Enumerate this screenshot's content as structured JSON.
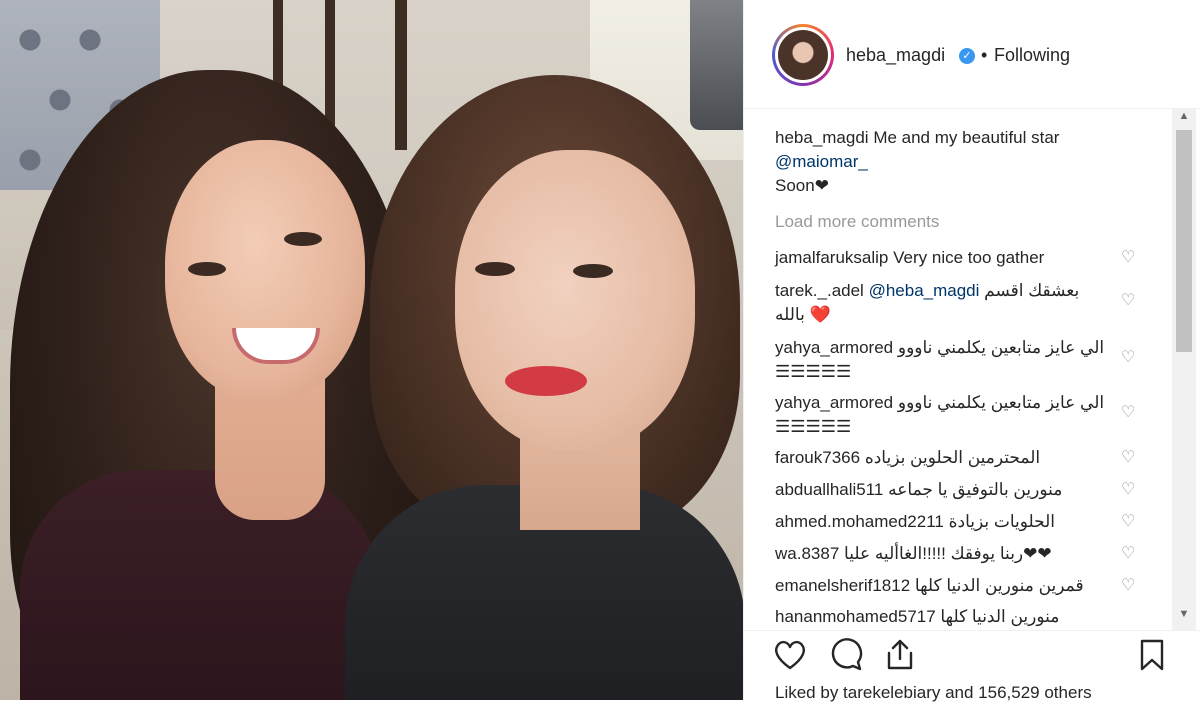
{
  "post": {
    "username": "heba_magdi",
    "verified": true,
    "separator": "•",
    "follow_status": "Following",
    "caption": {
      "user": "heba_magdi",
      "text": "Me and my beautiful star",
      "mention": "@maiomar_",
      "line3": "Soon❤"
    },
    "load_more": "Load more comments",
    "likes_text": "Liked by tarekelebiary and 156,529 others"
  },
  "comments": [
    {
      "user": "jamalfaruksalip",
      "mention": "",
      "text": "Very nice too gather",
      "cont": ""
    },
    {
      "user": "tarek._.adel",
      "mention": "@heba_magdi",
      "text": "بعشقك اقسم",
      "cont": "بالله ❤️"
    },
    {
      "user": "yahya_armored",
      "mention": "",
      "text": "الي عايز متابعين يكلمني ناووو",
      "cont": "☰☰☰☰☰"
    },
    {
      "user": "yahya_armored",
      "mention": "",
      "text": "الي عايز متابعين يكلمني ناووو",
      "cont": "☰☰☰☰☰"
    },
    {
      "user": "farouk7366",
      "mention": "",
      "text": "المحترمين الحلوين بزياده",
      "cont": ""
    },
    {
      "user": "abduallhali511",
      "mention": "",
      "text": "منورين بالتوفيق يا جماعه",
      "cont": ""
    },
    {
      "user": "ahmed.mohamed2211",
      "mention": "",
      "text": "الحلويات بزيادة",
      "cont": ""
    },
    {
      "user": "wa.8387",
      "mention": "",
      "text": "ربنا يوفقك !!!!!الغاأليه عليا❤❤",
      "cont": ""
    },
    {
      "user": "emanelsherif1812",
      "mention": "",
      "text": "قمرين منورين الدنيا كلها",
      "cont": ""
    },
    {
      "user": "hananmohamed5717",
      "mention": "",
      "text": "منورين الدنيا كلها",
      "cont": ""
    }
  ],
  "icons": {
    "heart": "heart-icon",
    "comment": "comment-icon",
    "share": "share-icon",
    "save": "bookmark-icon"
  },
  "colors": {
    "verified": "#3897f0",
    "mention": "#003569",
    "muted": "#999999"
  }
}
